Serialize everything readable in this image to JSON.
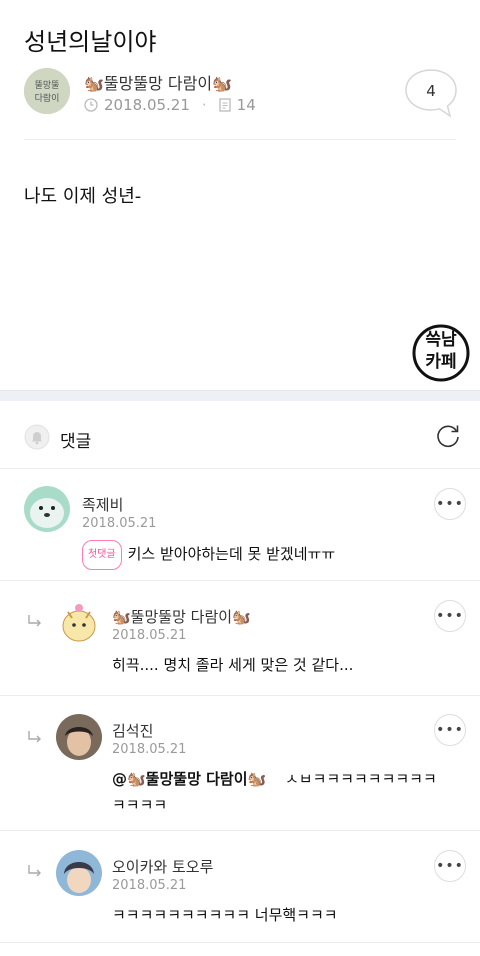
{
  "post": {
    "title": "성년의날이야",
    "author": "🐿️뚤망뚤망 다람이🐿️",
    "date": "2018.05.21",
    "views": "14",
    "comment_count": "4",
    "content": "나도 이제 성년-",
    "avatar_text": "뚤망뚤망 다람이"
  },
  "badge": {
    "line1": "쓱남",
    "line2": "카페"
  },
  "comments_section": {
    "title": "댓글"
  },
  "comments": [
    {
      "name": "족제비",
      "date": "2018.05.21",
      "first_badge": "첫댓글",
      "text": "키스 받아야하는데 못 받겠네ㅠㅠ",
      "reply": false
    },
    {
      "name": "🐿️뚤망뚤망 다람이🐿️",
      "date": "2018.05.21",
      "text": "히끅.... 명치 졸라 세게 맞은 것 같다...",
      "reply": true
    },
    {
      "name": "김석진",
      "date": "2018.05.21",
      "mention": "@🐿️뚤망뚤망 다람이🐿️",
      "text": "ㅅㅂㅋㅋㅋㅋㅋㅋㅋㅋㅋ",
      "text2": "ㅋㅋㅋㅋ",
      "reply": true
    },
    {
      "name": "오이카와 토오루",
      "date": "2018.05.21",
      "text": "ㅋㅋㅋㅋㅋㅋㅋㅋㅋㅋ 너무핵ㅋㅋㅋ",
      "reply": true
    }
  ],
  "colors": {
    "divider": "#ececec",
    "accent_pink": "#ff4e9e",
    "meta_gray": "#999999"
  },
  "icons": [
    "clock-icon",
    "document-icon",
    "speech-bubble-icon",
    "bell-icon",
    "refresh-icon",
    "more-icon",
    "reply-arrow-icon"
  ]
}
